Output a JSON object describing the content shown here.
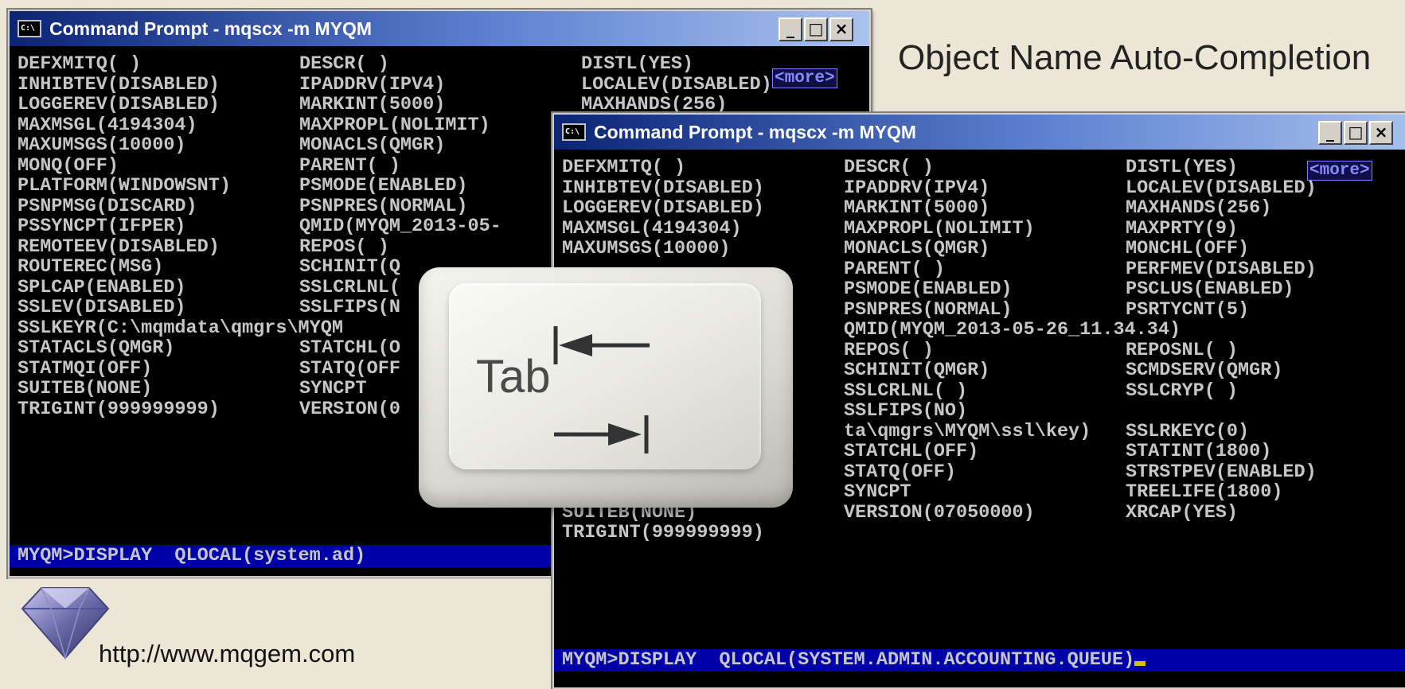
{
  "slide": {
    "title": "Object Name Auto-Completion",
    "url": "http://www.mqgem.com"
  },
  "window_back": {
    "title": "Command Prompt - mqscx  -m MYQM",
    "more_label": "<more>",
    "columns": [
      [
        "DEFXMITQ( )",
        "INHIBTEV(DISABLED)",
        "LOGGEREV(DISABLED)",
        "MAXMSGL(4194304)",
        "MAXUMSGS(10000)",
        "MONQ(OFF)",
        "PLATFORM(WINDOWSNT)",
        "PSNPMSG(DISCARD)",
        "PSSYNCPT(IFPER)",
        "REMOTEEV(DISABLED)",
        "ROUTEREC(MSG)",
        "SPLCAP(ENABLED)",
        "SSLEV(DISABLED)",
        "SSLKEYR(C:\\mqmdata\\qmgrs\\MYQM",
        "STATACLS(QMGR)",
        "STATMQI(OFF)",
        "SUITEB(NONE)",
        "TRIGINT(999999999)"
      ],
      [
        "DESCR( )",
        "IPADDRV(IPV4)",
        "MARKINT(5000)",
        "MAXPROPL(NOLIMIT)",
        "MONACLS(QMGR)",
        "PARENT( )",
        "PSMODE(ENABLED)",
        "PSNPRES(NORMAL)",
        "QMID(MYQM_2013-05-",
        "REPOS( )",
        "SCHINIT(Q",
        "SSLCRLNL(",
        "SSLFIPS(N",
        "",
        "STATCHL(O",
        "STATQ(OFF",
        "SYNCPT",
        "VERSION(0"
      ],
      [
        "DISTL(YES)",
        "LOCALEV(DISABLED)",
        "MAXHANDS(256)"
      ]
    ],
    "command": "MYQM>DISPLAY  QLOCAL(system.ad)"
  },
  "window_front": {
    "title": "Command Prompt - mqscx  -m MYQM",
    "more_label": "<more>",
    "columns": [
      [
        "DEFXMITQ( )",
        "INHIBTEV(DISABLED)",
        "LOGGEREV(DISABLED)",
        "MAXMSGL(4194304)",
        "MAXUMSGS(10000)",
        "",
        "",
        "",
        "",
        "",
        "",
        "",
        "",
        "",
        "",
        "",
        "",
        "SUITEB(NONE)",
        "TRIGINT(999999999)"
      ],
      [
        "DESCR( )",
        "IPADDRV(IPV4)",
        "MARKINT(5000)",
        "MAXPROPL(NOLIMIT)",
        "MONACLS(QMGR)",
        "PARENT( )",
        "PSMODE(ENABLED)",
        "PSNPRES(NORMAL)",
        "QMID(MYQM_2013-05-26_11.34.34)",
        "REPOS( )",
        "SCHINIT(QMGR)",
        "SSLCRLNL( )",
        "SSLFIPS(NO)",
        "ta\\qmgrs\\MYQM\\ssl\\key)",
        "STATCHL(OFF)",
        "STATQ(OFF)",
        "SYNCPT",
        "VERSION(07050000)"
      ],
      [
        "DISTL(YES)",
        "LOCALEV(DISABLED)",
        "MAXHANDS(256)",
        "MAXPRTY(9)",
        "MONCHL(OFF)",
        "PERFMEV(DISABLED)",
        "PSCLUS(ENABLED)",
        "PSRTYCNT(5)",
        "",
        "REPOSNL( )",
        "SCMDSERV(QMGR)",
        "SSLCRYP( )",
        "",
        "SSLRKEYC(0)",
        "STATINT(1800)",
        "STRSTPEV(ENABLED)",
        "TREELIFE(1800)",
        "XRCAP(YES)"
      ]
    ],
    "command": "MYQM>DISPLAY  QLOCAL(SYSTEM.ADMIN.ACCOUNTING.QUEUE)"
  },
  "tab_key": {
    "label": "Tab"
  }
}
